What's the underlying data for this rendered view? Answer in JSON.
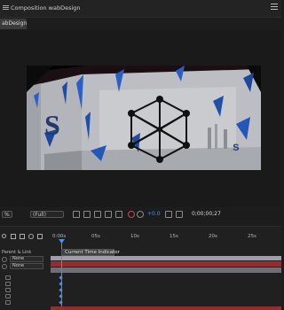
{
  "header": {
    "title": "Composition wabDesign"
  },
  "comp_tab": {
    "label": "abDesign"
  },
  "viewer": {
    "zoom": "%",
    "resolution": "(Full)",
    "exposure": "+0.0",
    "timecode": "0;00;00;27"
  },
  "timeline": {
    "ruler_ticks": [
      "0:00s",
      "05s",
      "10s",
      "15s",
      "20s",
      "25s"
    ],
    "cti_tooltip": "Current Time Indicator",
    "parent_label": "Parent & Link",
    "parent_values": [
      "None",
      "None"
    ]
  },
  "colors": {
    "accent": "#4a8ff0",
    "layer_red": "#8f2f2f",
    "work_area": "#9d9dab"
  }
}
